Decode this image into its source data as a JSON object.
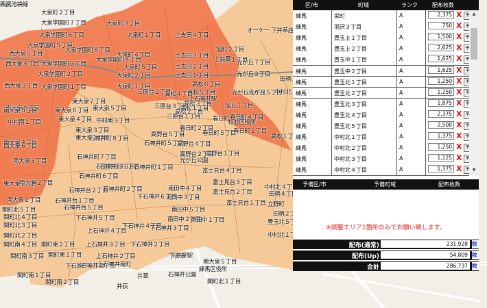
{
  "map": {
    "labels": [
      [
        "大泉町２丁目",
        "t"
      ],
      [
        "大泉学園町７丁目",
        "t"
      ],
      [
        "大泉学園町６丁目",
        "t"
      ],
      [
        "大泉学園町５丁目",
        "t"
      ],
      [
        "大泉町３丁目",
        "t"
      ],
      [
        "大泉町１丁目",
        "t"
      ],
      [
        "土支田４丁目",
        "t"
      ],
      [
        "旭町２丁目",
        "t"
      ],
      [
        "大泉学園町８丁目",
        "t"
      ],
      [
        "西大泉５丁目",
        "t"
      ],
      [
        "大泉学園町４丁目",
        "t"
      ],
      [
        "大泉町４丁目",
        "t"
      ],
      [
        "土支田３丁目",
        "t"
      ],
      [
        "旭町１丁目",
        "t"
      ],
      [
        "西大泉４丁目",
        "t"
      ],
      [
        "大泉学園町３丁目",
        "t"
      ],
      [
        "大泉町５丁目",
        "t"
      ],
      [
        "土支田２丁目",
        "t"
      ],
      [
        "光が丘７丁目",
        "t"
      ],
      [
        "大泉学園町２丁目",
        "t"
      ],
      [
        "大泉町２丁目",
        "t"
      ],
      [
        "土支田１丁目",
        "t"
      ],
      [
        "高松６丁目",
        "t"
      ],
      [
        "光が丘３丁目",
        "t"
      ],
      [
        "西大泉３丁目",
        "t"
      ],
      [
        "大泉学園町１丁目",
        "t"
      ],
      [
        "大泉町１丁目",
        "t"
      ],
      [
        "高松５丁目",
        "t"
      ],
      [
        "光が丘６丁目",
        "t"
      ],
      [
        "光が丘５丁目",
        "t"
      ],
      [
        "南大泉６丁目",
        "t"
      ],
      [
        "東大泉７丁目",
        "t"
      ],
      [
        "三原台２丁目",
        "t"
      ],
      [
        "高松４丁目",
        "t"
      ],
      [
        "東大泉６丁目",
        "t"
      ],
      [
        "東大泉５丁目",
        "t"
      ],
      [
        "三原台３丁目",
        "t"
      ],
      [
        "高松２丁目",
        "t"
      ],
      [
        "旭丘１丁目",
        "t"
      ],
      [
        "高松３丁目",
        "t"
      ],
      [
        "南大泉５丁目",
        "t"
      ],
      [
        "東大泉４丁目",
        "t"
      ],
      [
        "三原台１丁目",
        "t"
      ],
      [
        "高松１丁目",
        "t"
      ],
      [
        "春日町３丁目",
        "t"
      ],
      [
        "春日町４丁目",
        "t"
      ],
      [
        "東大泉３丁目",
        "t"
      ],
      [
        "東大泉１丁目",
        "t"
      ],
      [
        "高野台５丁目",
        "t"
      ],
      [
        "春日町５丁目",
        "t"
      ],
      [
        "春日町２丁目",
        "t"
      ],
      [
        "南大泉４丁目",
        "t"
      ],
      [
        "石神井町８丁目",
        "t"
      ],
      [
        "石神井町５丁目",
        "t"
      ],
      [
        "高野台４丁目",
        "t"
      ],
      [
        "春日町１丁目",
        "t"
      ],
      [
        "南大泉３丁目",
        "t"
      ],
      [
        "石神井町７丁目",
        "t"
      ],
      [
        "石神井町４丁目",
        "t"
      ],
      [
        "高野台１丁目",
        "t"
      ],
      [
        "富士見台４丁目",
        "t"
      ],
      [
        "石神井町３丁目",
        "t"
      ],
      [
        "石神井町１丁目",
        "t"
      ],
      [
        "高野台２丁目",
        "t"
      ],
      [
        "南大泉２丁目",
        "t"
      ],
      [
        "石神井町６丁目",
        "t"
      ],
      [
        "富士見台３丁目",
        "t"
      ],
      [
        "石神井台２丁目",
        "t"
      ],
      [
        "石神井町２丁目",
        "t"
      ],
      [
        "南田中４丁目",
        "t"
      ],
      [
        "南大泉１丁目",
        "t"
      ],
      [
        "石神井台１丁目",
        "t"
      ],
      [
        "南田中３丁目",
        "t"
      ],
      [
        "富士見台２丁目",
        "t"
      ],
      [
        "関町北５丁目",
        "t"
      ],
      [
        "石神井台５丁目",
        "t"
      ],
      [
        "下石神井６丁目",
        "t"
      ],
      [
        "南田中５丁目",
        "t"
      ],
      [
        "富士見台１丁目",
        "t"
      ],
      [
        "関町北４丁目",
        "t"
      ],
      [
        "下石神井５丁目",
        "t"
      ],
      [
        "南田中２丁目",
        "t"
      ],
      [
        "南田中１丁目",
        "t"
      ],
      [
        "関町北３丁目",
        "t"
      ],
      [
        "上石神井４丁目",
        "t"
      ],
      [
        "下石神井４丁目",
        "t"
      ],
      [
        "下石神井３丁目",
        "t"
      ],
      [
        "関町北２丁目",
        "t"
      ],
      [
        "関町東２丁目",
        "t"
      ],
      [
        "上石神井３丁目",
        "t"
      ],
      [
        "下石神井２丁目",
        "t"
      ],
      [
        "関町東１丁目",
        "t"
      ],
      [
        "上石神井２丁目",
        "t"
      ],
      [
        "下石神井１丁目",
        "t"
      ],
      [
        "関町南４丁目",
        "t"
      ],
      [
        "関町南３丁目",
        "t"
      ],
      [
        "上石神井１丁目",
        "t"
      ],
      [
        "上石神井南町",
        "t"
      ],
      [
        "関町南１丁目",
        "t"
      ],
      [
        "関町南２丁目",
        "t"
      ],
      [
        "立野町",
        "t"
      ],
      [
        "中村北４丁目",
        "t"
      ],
      [
        "中村北３丁目",
        "t"
      ],
      [
        "高松１丁目",
        "t"
      ],
      [
        "田柄１丁目",
        "t"
      ],
      [
        "田柄４丁目",
        "t"
      ],
      [
        "田柄２丁目",
        "t"
      ],
      [
        "豊玉北５丁目",
        "t"
      ],
      [
        "中村北１丁目",
        "t"
      ],
      [
        "中村南１丁目",
        "t"
      ],
      [
        "中村南３丁目",
        "t"
      ],
      [
        "西大泉６丁目",
        "t"
      ],
      [
        "東大泉２丁目",
        "t"
      ],
      [
        "南大泉５丁目",
        "t"
      ],
      [
        "関町北１丁目",
        "t"
      ],
      [
        "井草",
        "t"
      ],
      [
        "下井草",
        "t"
      ],
      [
        "上井草",
        "t"
      ],
      [
        "杉並区役所",
        "t"
      ],
      [
        "光が丘公園",
        "t"
      ],
      [
        "練馬区役所",
        "t"
      ],
      [
        "石神井公園",
        "t"
      ],
      [
        "井荻",
        "t"
      ],
      [
        "下井草駅",
        "t"
      ],
      [
        "上石神井駅",
        "t"
      ],
      [
        "オーケー 下井草店",
        "t"
      ],
      [
        "練馬",
        "t"
      ],
      [
        "西武池袋線",
        "t"
      ]
    ]
  },
  "table": {
    "headers": {
      "ward": "区/市",
      "town": "町域",
      "rank": "ランク",
      "count": "配布枚数"
    },
    "rows": [
      {
        "ward": "練馬",
        "town": "栄町",
        "rank": "A",
        "count": "2,375",
        "x": "X",
        "btn": "予"
      },
      {
        "ward": "練馬",
        "town": "羽沢３丁目",
        "rank": "A",
        "count": "750",
        "x": "X",
        "btn": "予"
      },
      {
        "ward": "練馬",
        "town": "豊玉上１丁目",
        "rank": "A",
        "count": "1,500",
        "x": "X",
        "btn": "予"
      },
      {
        "ward": "練馬",
        "town": "豊玉上２丁目",
        "rank": "A",
        "count": "2,625",
        "x": "X",
        "btn": "予"
      },
      {
        "ward": "練馬",
        "town": "豊玉中１丁目",
        "rank": "A",
        "count": "1,625",
        "x": "X",
        "btn": "予"
      },
      {
        "ward": "練馬",
        "town": "豊玉中２丁目",
        "rank": "A",
        "count": "1,625",
        "x": "X",
        "btn": "予"
      },
      {
        "ward": "練馬",
        "town": "豊玉北１丁目",
        "rank": "A",
        "count": "1,250",
        "x": "X",
        "btn": "予"
      },
      {
        "ward": "練馬",
        "town": "豊玉北２丁目",
        "rank": "A",
        "count": "1,250",
        "x": "X",
        "btn": "予"
      },
      {
        "ward": "練馬",
        "town": "豊玉北３丁目",
        "rank": "A",
        "count": "1,875",
        "x": "X",
        "btn": "予"
      },
      {
        "ward": "練馬",
        "town": "豊玉北４丁目",
        "rank": "A",
        "count": "2,375",
        "x": "X",
        "btn": "予"
      },
      {
        "ward": "練馬",
        "town": "豊玉北５丁目",
        "rank": "A",
        "count": "2,500",
        "x": "X",
        "btn": "予"
      },
      {
        "ward": "練馬",
        "town": "中村北１丁目",
        "rank": "A",
        "count": "1,375",
        "x": "X",
        "btn": "予"
      },
      {
        "ward": "練馬",
        "town": "中村北２丁目",
        "rank": "A",
        "count": "1,250",
        "x": "X",
        "btn": "予"
      },
      {
        "ward": "練馬",
        "town": "中村北３丁目",
        "rank": "A",
        "count": "1,125",
        "x": "X",
        "btn": "予"
      },
      {
        "ward": "練馬",
        "town": "中村北４丁目",
        "rank": "A",
        "count": "1,375",
        "x": "X",
        "btn": "予"
      }
    ]
  },
  "reserve": {
    "headers": {
      "ward": "予備区/市",
      "town": "予備町域",
      "count": "配布枚数"
    }
  },
  "notice": "※調整エリア1箇所のみでお願い致します。",
  "totals": {
    "normal_label": "配布(通常)",
    "normal_value": "231,928",
    "up_label": "配布(Up)",
    "up_value": "54,809",
    "sum_label": "合計",
    "sum_value": "286,737",
    "unit": "枚"
  },
  "colors": {
    "red_zone": "#f0784f",
    "orange_zone": "#f6c890",
    "base_map": "#f4f1ea",
    "notice": "#e0201a"
  }
}
